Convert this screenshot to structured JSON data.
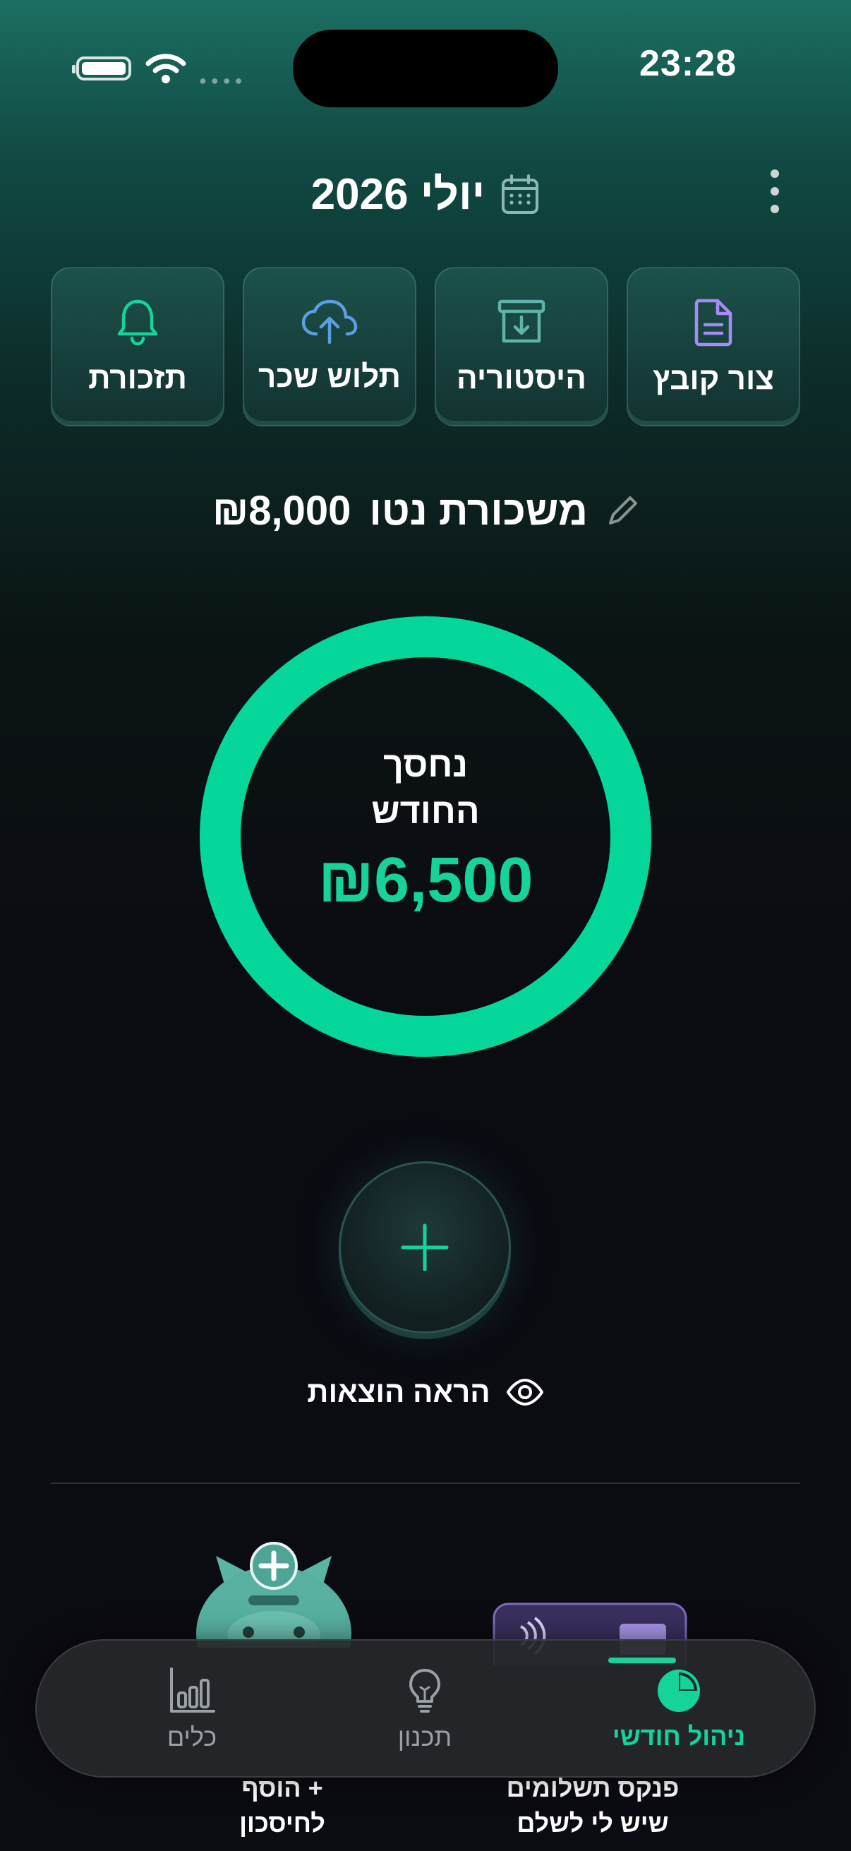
{
  "status_bar": {
    "time": "23:28",
    "icons": [
      "battery-icon",
      "wifi-icon",
      "cellular-signal-icon"
    ]
  },
  "header": {
    "month_title": "יולי 2026",
    "icons": [
      "calendar-icon",
      "more-vertical-icon"
    ]
  },
  "quick_actions": [
    {
      "label": "צור קובץ",
      "icon": "file-icon",
      "color": "#a78bfa"
    },
    {
      "label": "היסטוריה",
      "icon": "archive-download-icon",
      "color": "#5fb3a8"
    },
    {
      "label": "תלוש שכר",
      "icon": "cloud-upload-icon",
      "color": "#5b9fe0"
    },
    {
      "label": "תזכורת",
      "icon": "bell-icon",
      "color": "#16d39a"
    }
  ],
  "salary": {
    "label": "משכורת נטו",
    "amount": "₪8,000",
    "icon": "pencil-icon"
  },
  "savings_ring": {
    "label_line1": "נחסך",
    "label_line2": "החודש",
    "amount": "₪6,500",
    "ring_color": "#05d69a"
  },
  "add_button": {
    "icon": "plus-icon"
  },
  "show_expenses": {
    "label": "הראה הוצאות",
    "icon": "eye-icon"
  },
  "tools": [
    {
      "label_line1": "+ הוסף",
      "label_line2": "לחיסכון",
      "icon": "piggy-bank-icon"
    },
    {
      "label_line1": "פנקס תשלומים",
      "label_line2": "שיש לי לשלם",
      "icon": "wallet-card-icon"
    }
  ],
  "tab_bar": {
    "tabs": [
      {
        "label": "כלים",
        "icon": "bar-chart-icon",
        "active": false
      },
      {
        "label": "תכנון",
        "icon": "lightbulb-icon",
        "active": false
      },
      {
        "label": "ניהול חודשי",
        "icon": "pie-chart-icon",
        "active": true
      }
    ],
    "active_color": "#16d39a",
    "inactive_color": "#9aa0a3"
  }
}
